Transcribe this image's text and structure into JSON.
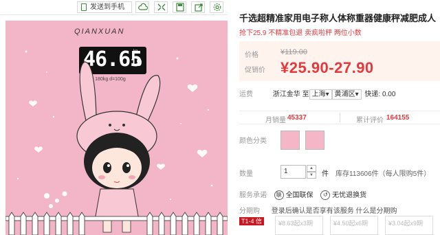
{
  "toolbar": {
    "send_to_phone": "发送到手机"
  },
  "product_image": {
    "brand": "QIANXUAN",
    "display_value": "46.65",
    "display_side": "19",
    "display_unit": "kg",
    "spec_text": "Max 180kg d=100g"
  },
  "product": {
    "title": "千选超精准家用电子称人体称重器健康秤减肥成人",
    "promo": "抢下25.9 不精准包退 卖疯啦秤 两位小数"
  },
  "price": {
    "label_price": "价格",
    "old_price": "¥119.00",
    "label_promo": "促销价",
    "current_price": "¥25.90-27.90"
  },
  "shipping": {
    "label": "运费",
    "origin": "浙江金华",
    "to": "至",
    "dest_province": "上海",
    "dest_district": "黄浦区",
    "method": "快递: 0.00"
  },
  "stats": {
    "monthly_sales_label": "月销量",
    "monthly_sales": "45337",
    "reviews_label": "累计评价",
    "reviews": "164155"
  },
  "color": {
    "label": "颜色分类"
  },
  "quantity": {
    "label": "数量",
    "value": "1",
    "unit": "件",
    "stock": "库存113606件（每人限购5件）"
  },
  "service": {
    "label": "服务承诺",
    "badge1_icon": "联",
    "item1": "全国联保",
    "item2": "无忧退换货"
  },
  "installment": {
    "label": "分期购",
    "notice": "登录后确认是否享有该服务 什么是分期购",
    "badge": "T1-4 信",
    "options": [
      "¥8.63起x3期",
      "¥4.50起x6期",
      "¥3.04起x9期"
    ]
  },
  "colors": {
    "accent": "#e4393c",
    "pink": "#f3b6c8"
  }
}
